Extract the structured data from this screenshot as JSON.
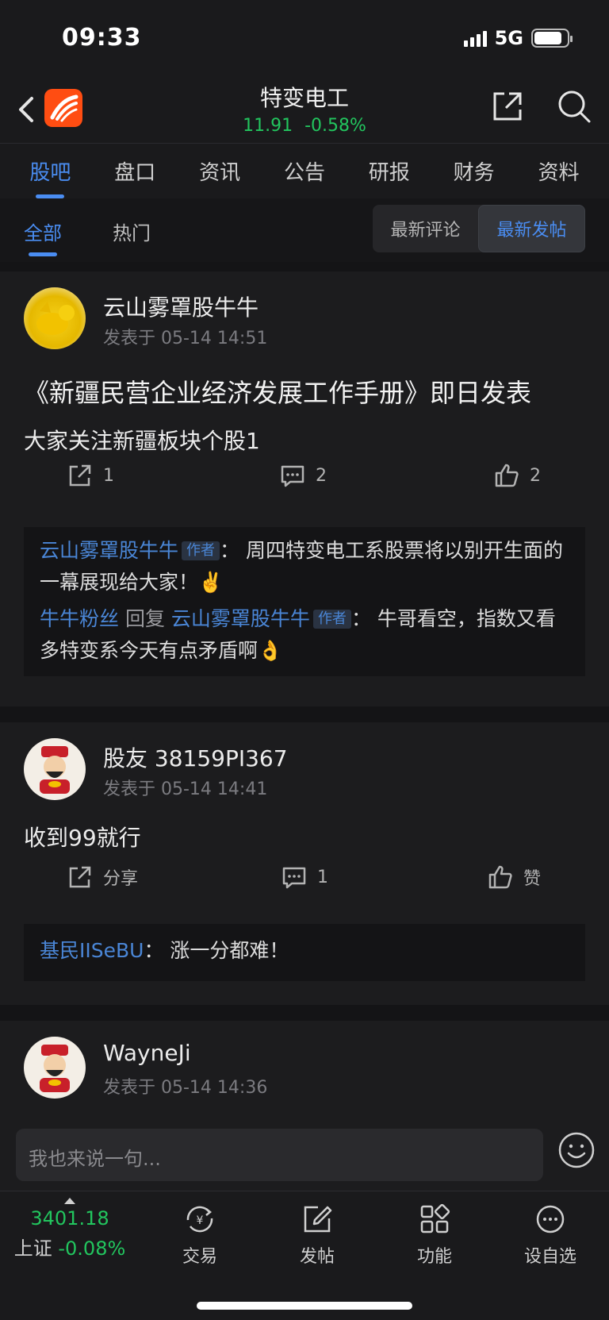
{
  "status": {
    "time": "09:33",
    "network": "5G"
  },
  "header": {
    "title": "特变电工",
    "price": "11.91",
    "change": "-0.58%"
  },
  "tabs": [
    "股吧",
    "盘口",
    "资讯",
    "公告",
    "研报",
    "财务",
    "资料"
  ],
  "subtabs": {
    "all": "全部",
    "hot": "热门",
    "latest_comment": "最新评论",
    "latest_post": "最新发帖"
  },
  "posts": [
    {
      "user": "云山雾罩股牛牛",
      "time": "发表于 05-14 14:51",
      "title": "《新疆民营企业经济发展工作手册》即日发表",
      "body": "大家关注新疆板块个股1",
      "share": "1",
      "comments": "2",
      "likes": "2",
      "replies": [
        {
          "name": "云山雾罩股牛牛",
          "tag": "作者",
          "text": "：  周四特变电工系股票将以别开生面的一幕展现给大家！✌️"
        },
        {
          "name": "牛牛粉丝",
          "mid": " 回复 ",
          "name2": "云山雾罩股牛牛",
          "tag": "作者",
          "text": "：  牛哥看空，指数又看多特变系今天有点矛盾啊👌"
        }
      ]
    },
    {
      "user": "股友 38159PI367",
      "time": "发表于 05-14 14:41",
      "body": "收到99就行",
      "share": "分享",
      "comments": "1",
      "likes": "赞",
      "reply": {
        "name": "基民IISeBU",
        "text": "：  涨一分都难！"
      }
    },
    {
      "user": "WayneJi",
      "time": "发表于 05-14 14:36"
    }
  ],
  "comment_bar": {
    "placeholder": "我也来说一句..."
  },
  "bottom_nav": {
    "index_value": "3401.18",
    "index_name": "上证",
    "index_change": "-0.08%",
    "items": [
      "交易",
      "发帖",
      "功能",
      "设自选"
    ]
  }
}
